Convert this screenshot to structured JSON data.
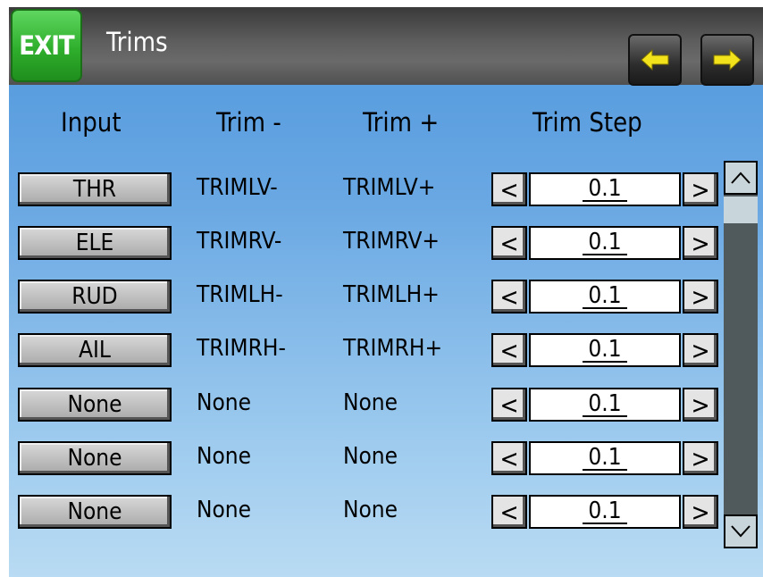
{
  "header": {
    "exit_label": "EXIT",
    "title": "Trims",
    "prev_icon": "arrow-left-icon",
    "next_icon": "arrow-right-icon",
    "nav_arrow_color": "#f2e21b"
  },
  "columns": {
    "input": "Input",
    "trim_minus": "Trim -",
    "trim_plus": "Trim +",
    "trim_step": "Trim Step"
  },
  "rows": [
    {
      "input": "THR",
      "trim_minus": "TRIMLV-",
      "trim_plus": "TRIMLV+",
      "step": "0.1"
    },
    {
      "input": "ELE",
      "trim_minus": "TRIMRV-",
      "trim_plus": "TRIMRV+",
      "step": "0.1"
    },
    {
      "input": "RUD",
      "trim_minus": "TRIMLH-",
      "trim_plus": "TRIMLH+",
      "step": "0.1"
    },
    {
      "input": "AIL",
      "trim_minus": "TRIMRH-",
      "trim_plus": "TRIMRH+",
      "step": "0.1"
    },
    {
      "input": "None",
      "trim_minus": "None",
      "trim_plus": "None",
      "step": "0.1"
    },
    {
      "input": "None",
      "trim_minus": "None",
      "trim_plus": "None",
      "step": "0.1"
    },
    {
      "input": "None",
      "trim_minus": "None",
      "trim_plus": "None",
      "step": "0.1"
    }
  ],
  "stepper": {
    "dec_glyph": "<",
    "inc_glyph": ">"
  },
  "scroll": {
    "up_icon": "chevron-up-icon",
    "down_icon": "chevron-down-icon"
  }
}
